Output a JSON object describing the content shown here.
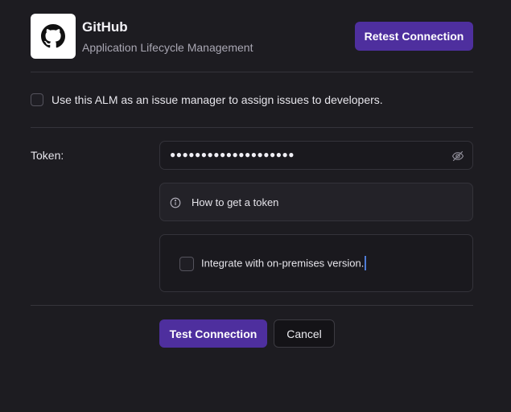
{
  "integration": {
    "name": "GitHub",
    "subtitle": "Application Lifecycle Management",
    "logo_icon": "github-icon",
    "retest_label": "Retest Connection"
  },
  "issue_manager": {
    "label": "Use this ALM as an issue manager to assign issues to developers.",
    "checked": false
  },
  "token": {
    "label": "Token:",
    "masked_value": "●●●●●●●●●●●●●●●●●●●●",
    "visibility_icon": "eye-off-icon"
  },
  "help": {
    "icon": "info-icon",
    "text": "How to get a token"
  },
  "on_premises": {
    "label": "Integrate with on-premises version.",
    "checked": false
  },
  "actions": {
    "test_label": "Test Connection",
    "cancel_label": "Cancel"
  },
  "colors": {
    "background": "#1d1c21",
    "accent": "#4e2f9e",
    "border": "#34333a",
    "caret": "#4f7cd6"
  }
}
